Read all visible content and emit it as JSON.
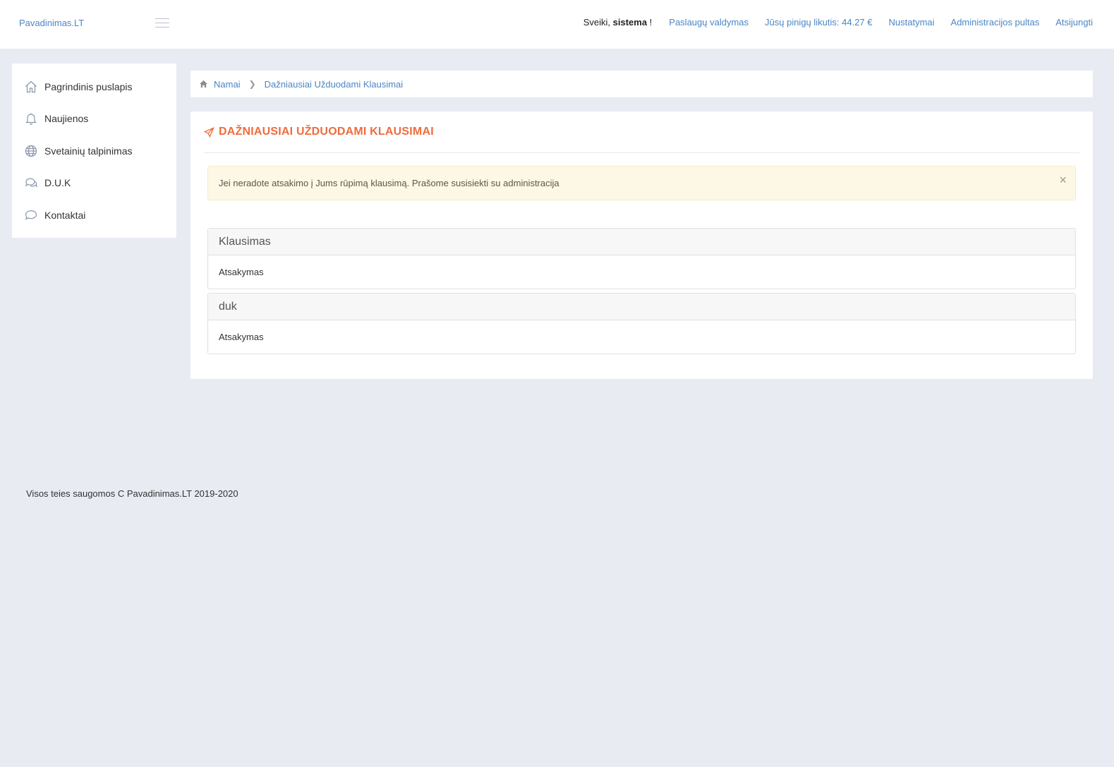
{
  "header": {
    "brand": "Pavadinimas.LT",
    "greeting_prefix": "Sveiki, ",
    "user": "sistema",
    "greeting_suffix": " !",
    "nav": [
      {
        "label": "Paslaugų valdymas"
      },
      {
        "label": "Jūsų pinigų likutis: 44.27 €"
      },
      {
        "label": "Nustatymai"
      },
      {
        "label": "Administracijos pultas"
      },
      {
        "label": "Atsijungti"
      }
    ]
  },
  "sidebar": {
    "items": [
      {
        "label": "Pagrindinis puslapis",
        "icon": "home-icon"
      },
      {
        "label": "Naujienos",
        "icon": "bell-icon"
      },
      {
        "label": "Svetainių talpinimas",
        "icon": "globe-icon"
      },
      {
        "label": "D.U.K",
        "icon": "chat-bubbles-icon"
      },
      {
        "label": "Kontaktai",
        "icon": "comment-icon"
      }
    ]
  },
  "breadcrumb": {
    "home": "Namai",
    "current": "Dažniausiai Užduodami Klausimai"
  },
  "main": {
    "title": "DAŽNIAUSIAI UŽDUODAMI KLAUSIMAI",
    "alert": "Jei neradote atsakimo į Jums rūpimą klausimą. Prašome susisiekti su administracija",
    "alert_close": "×",
    "faq": [
      {
        "question": "Klausimas",
        "answer": "Atsakymas"
      },
      {
        "question": "duk",
        "answer": "Atsakymas"
      }
    ]
  },
  "footer": {
    "text": "Visos teies saugomos C Pavadinimas.LT 2019-2020"
  },
  "colors": {
    "accent": "#ef6c3c",
    "link": "#4a86c5",
    "background": "#e8ebf2",
    "alert_bg": "#fdf8e5"
  }
}
